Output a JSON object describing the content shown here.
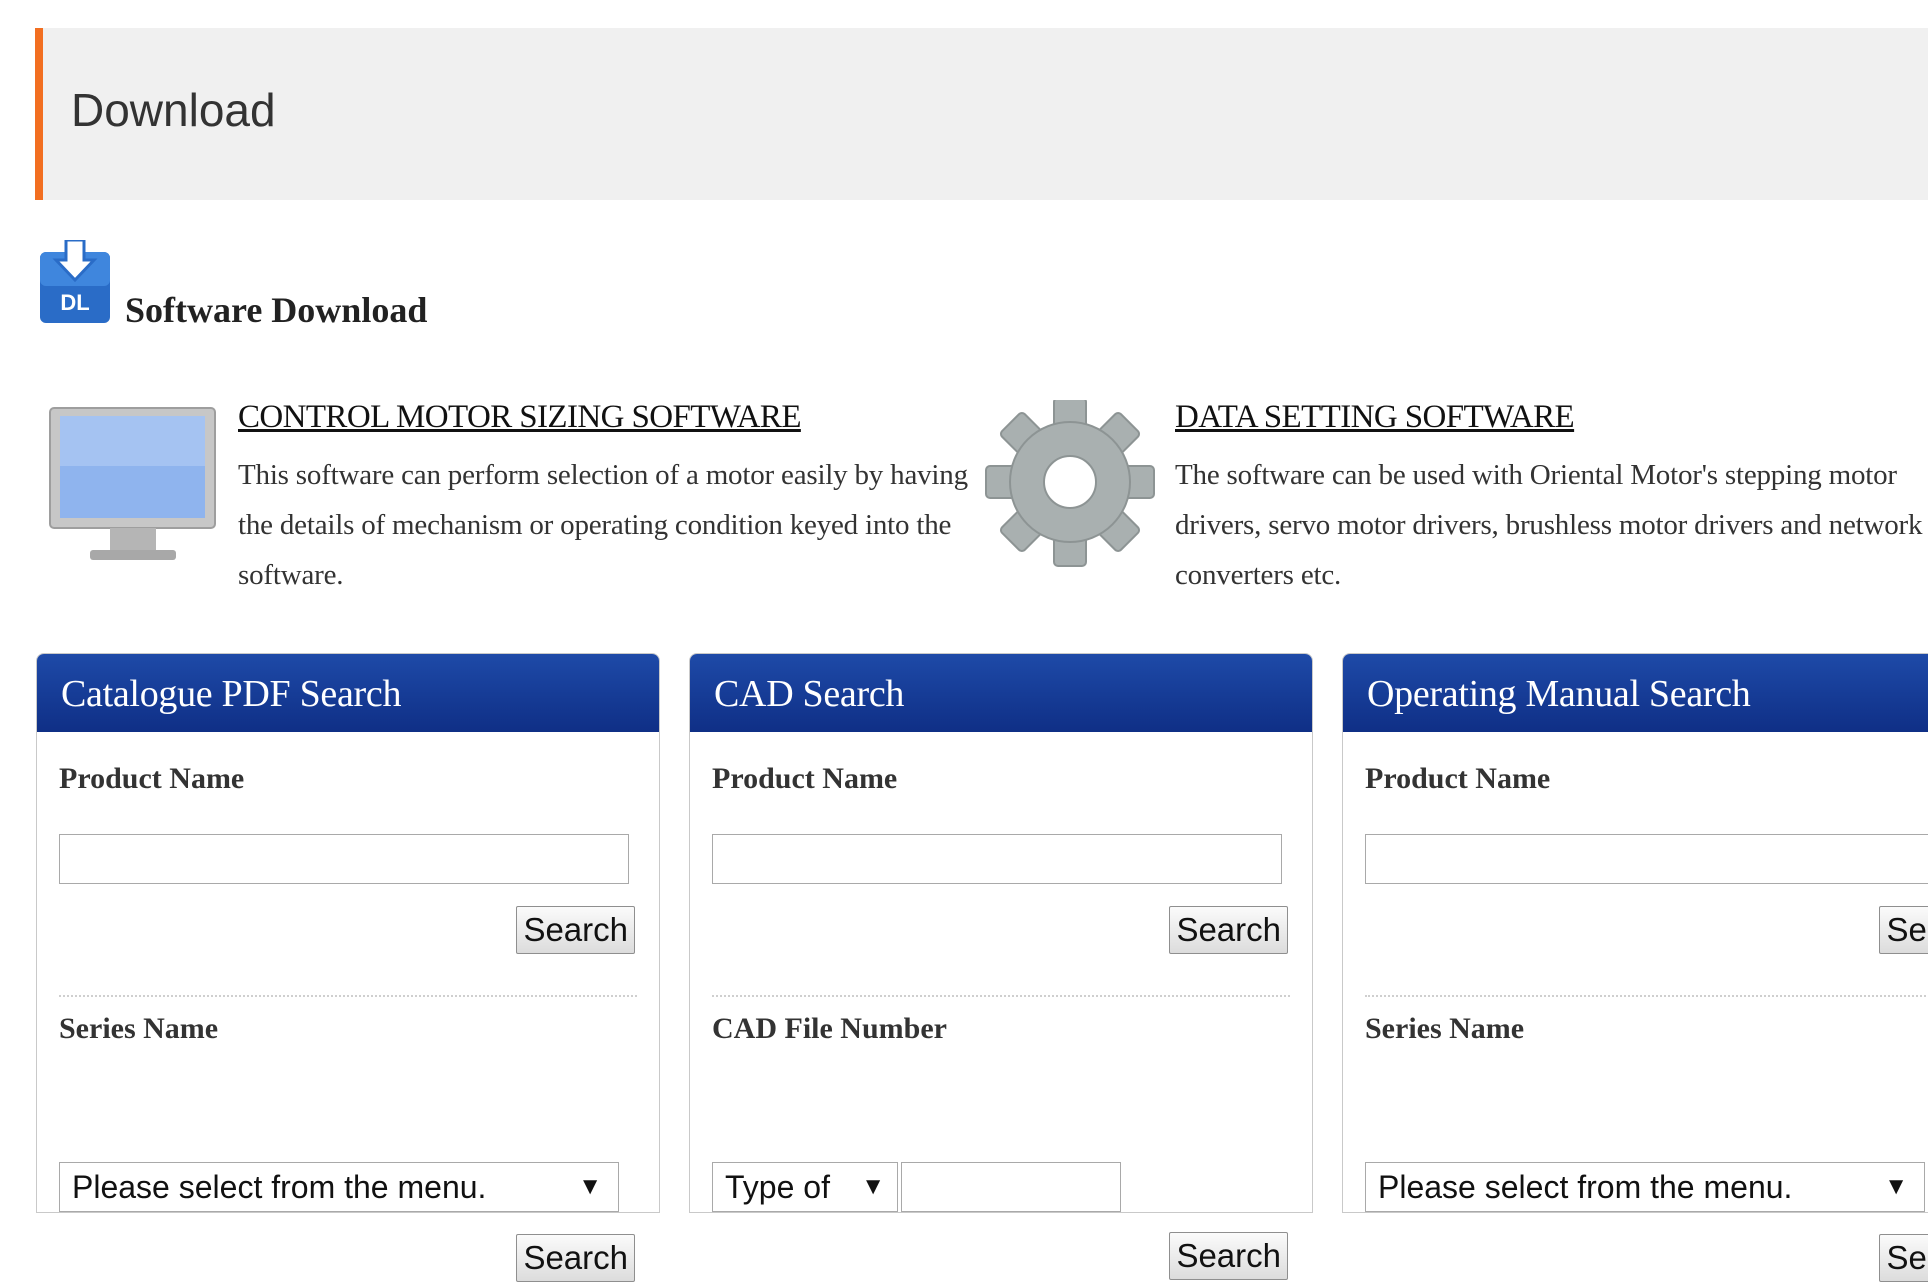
{
  "page": {
    "title": "Download"
  },
  "software_section": {
    "heading": "Software Download",
    "items": [
      {
        "title": "CONTROL MOTOR SIZING SOFTWARE",
        "description": "This software can perform selection of a motor easily by having the details of mechanism or operating condition keyed into the software."
      },
      {
        "title": "DATA SETTING SOFTWARE",
        "description": "The software can be used with Oriental Motor's stepping motor drivers, servo motor drivers, brushless motor drivers and network converters etc."
      }
    ]
  },
  "panels": {
    "catalogue": {
      "title": "Catalogue PDF Search",
      "product_label": "Product Name",
      "search_label": "Search",
      "series_label": "Series Name",
      "series_select": "Please select from the menu.",
      "search_label_2": "Search"
    },
    "cad": {
      "title": "CAD Search",
      "product_label": "Product Name",
      "search_label": "Search",
      "file_label": "CAD File Number",
      "type_select": "Type of",
      "search_label_2": "Search"
    },
    "manual": {
      "title": "Operating Manual Search",
      "product_label": "Product Name",
      "search_label": "Search",
      "series_label": "Series Name",
      "series_select": "Please select from the menu.",
      "search_label_2": "Search"
    }
  },
  "icons": {
    "download": "download-dl-icon",
    "monitor": "monitor-icon",
    "gear": "gear-icon",
    "dropdown": "dropdown-arrow-icon"
  },
  "colors": {
    "accent_orange": "#f26f21",
    "panel_header_blue": "#1a3f9a",
    "header_bg": "#f0f0f0"
  }
}
